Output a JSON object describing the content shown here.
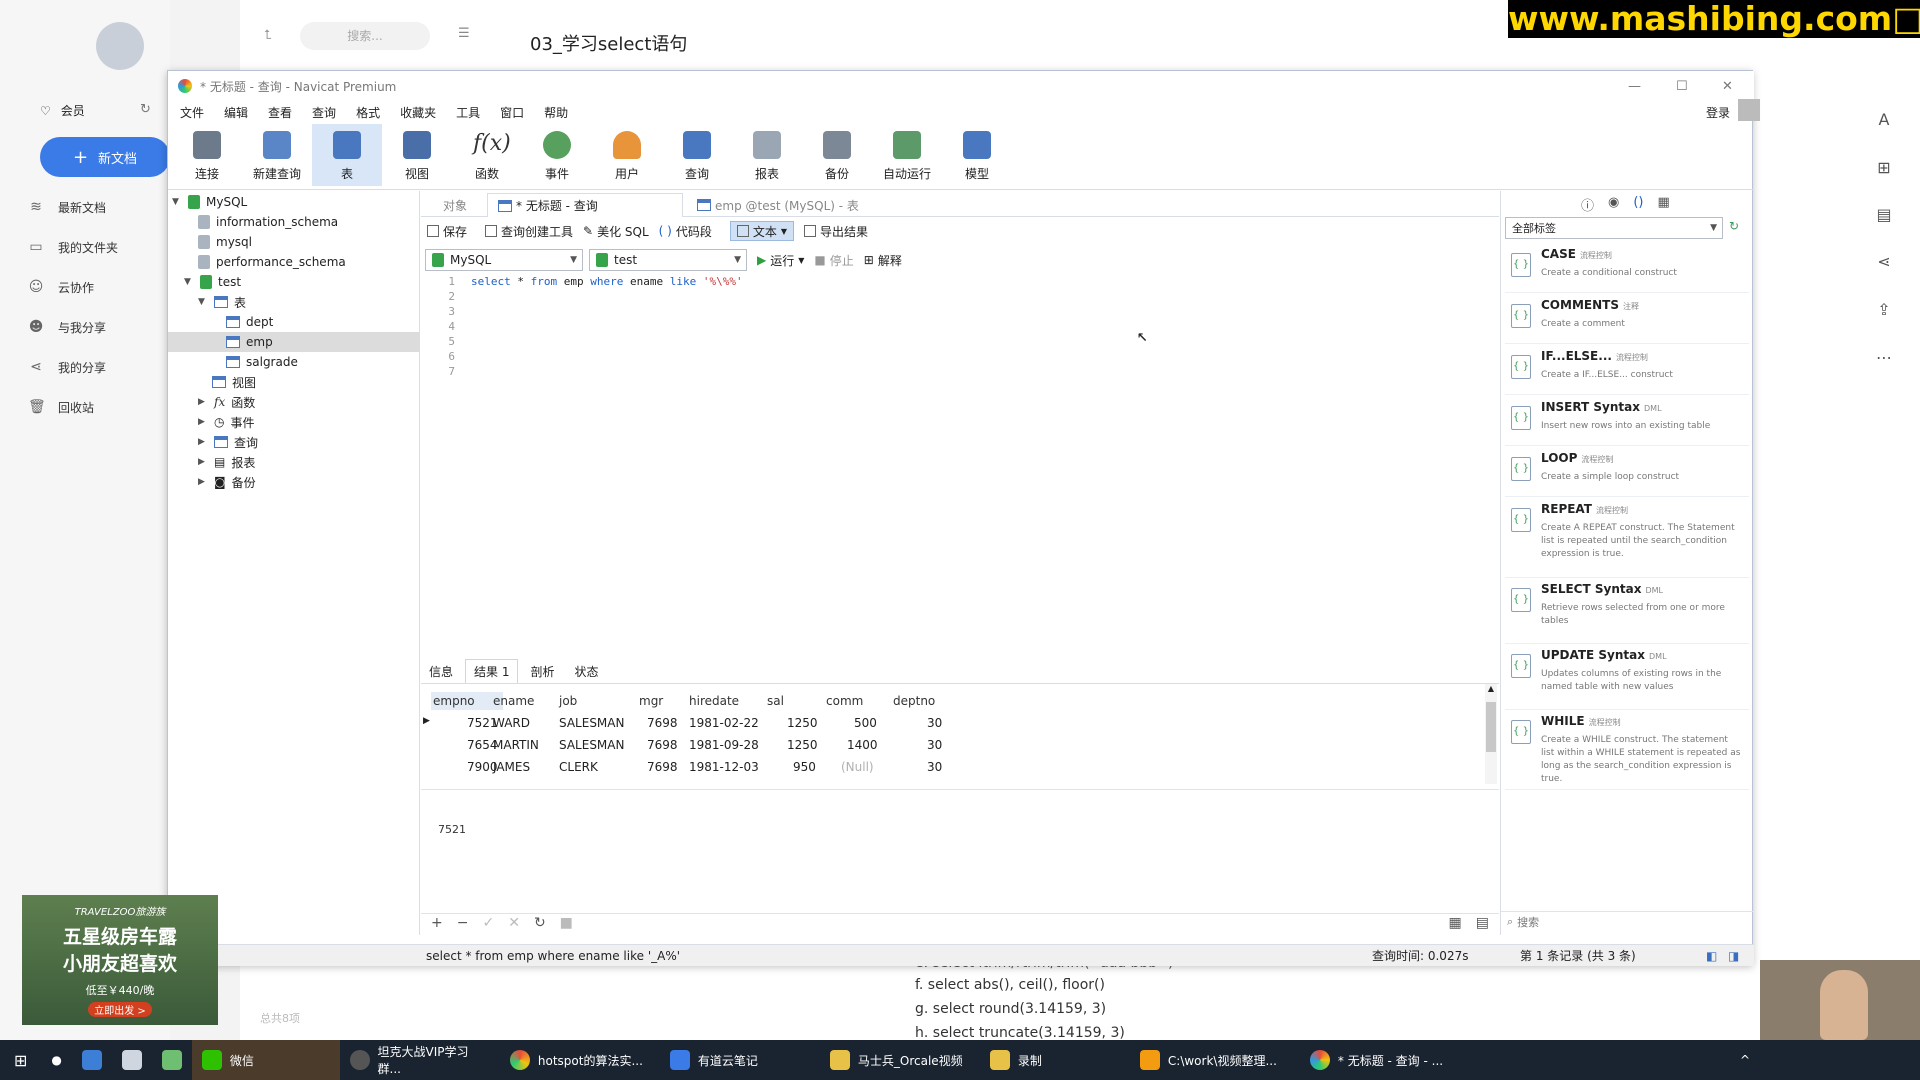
{
  "watermark": "www.mashibing.com□",
  "note_app": {
    "doc_title": "03_学习select语句",
    "search_placeholder": "搜索...",
    "member": "会员",
    "new_doc": "新文档",
    "sidebar": [
      {
        "label": "最新文档"
      },
      {
        "label": "我的文件夹"
      },
      {
        "label": "云协作"
      },
      {
        "label": "与我分享"
      },
      {
        "label": "我的分享"
      },
      {
        "label": "回收站"
      }
    ],
    "total": "总共8项",
    "note_lines": [
      "e. select ltrim/rtrim/trim(\"  aaa bbb  \")",
      "f. select abs(), ceil(), floor()",
      "g. select round(3.14159, 3)",
      "h. select truncate(3.14159, 3)"
    ]
  },
  "ad": {
    "brand": "TRAVELZOO旅游族",
    "line1": "五星级房车露",
    "line2": "小朋友超喜欢",
    "price": "低至￥440/晚",
    "cta": "立即出发 >"
  },
  "window": {
    "title": "* 无标题 - 查询 - Navicat Premium",
    "login": "登录",
    "menu": [
      "文件",
      "编辑",
      "查看",
      "查询",
      "格式",
      "收藏夹",
      "工具",
      "窗口",
      "帮助"
    ],
    "toolbar": [
      {
        "label": "连接"
      },
      {
        "label": "新建查询"
      },
      {
        "label": "表"
      },
      {
        "label": "视图"
      },
      {
        "label": "函数"
      },
      {
        "label": "事件"
      },
      {
        "label": "用户"
      },
      {
        "label": "查询"
      },
      {
        "label": "报表"
      },
      {
        "label": "备份"
      },
      {
        "label": "自动运行"
      },
      {
        "label": "模型"
      }
    ],
    "tree": {
      "root": "MySQL",
      "dbs": [
        "information_schema",
        "mysql",
        "performance_schema",
        "test"
      ],
      "tables_label": "表",
      "tables": [
        "dept",
        "emp",
        "salgrade"
      ],
      "others": [
        "视图",
        "函数",
        "事件",
        "查询",
        "报表",
        "备份"
      ]
    },
    "tabs": [
      "对象",
      "* 无标题 - 查询",
      "emp @test (MySQL) - 表"
    ],
    "query_toolbar": [
      "保存",
      "查询创建工具",
      "美化 SQL",
      "代码段",
      "文本",
      "导出结果"
    ],
    "conn_select": "MySQL",
    "db_select": "test",
    "run": "运行",
    "stop": "停止",
    "explain": "解释",
    "line_numbers": [
      "1",
      "2",
      "3",
      "4",
      "5",
      "6",
      "7"
    ],
    "sql": {
      "k1": "select",
      "star": " * ",
      "k2": "from",
      "t": " emp ",
      "k3": "where",
      "c": " ename ",
      "k4": "like",
      "s": " '%\\%%'"
    },
    "result_tabs": [
      "信息",
      "结果 1",
      "剖析",
      "状态"
    ],
    "columns": [
      "empno",
      "ename",
      "job",
      "mgr",
      "hiredate",
      "sal",
      "comm",
      "deptno"
    ],
    "rows": [
      [
        "7521",
        "WARD",
        "SALESMAN",
        "7698",
        "1981-02-22",
        "1250",
        "500",
        "30"
      ],
      [
        "7654",
        "MARTIN",
        "SALESMAN",
        "7698",
        "1981-09-28",
        "1250",
        "1400",
        "30"
      ],
      [
        "7900",
        "JAMES",
        "CLERK",
        "7698",
        "1981-12-03",
        "950",
        "(Null)",
        "30"
      ]
    ],
    "selected_value": "7521",
    "snippet_filter": "全部标签",
    "snippets": [
      {
        "title": "CASE",
        "tag": "流程控制",
        "desc": "Create a conditional construct"
      },
      {
        "title": "COMMENTS",
        "tag": "注释",
        "desc": "Create a comment"
      },
      {
        "title": "IF...ELSE...",
        "tag": "流程控制",
        "desc": "Create a IF...ELSE... construct"
      },
      {
        "title": "INSERT Syntax",
        "tag": "DML",
        "desc": "Insert new rows into an existing table"
      },
      {
        "title": "LOOP",
        "tag": "流程控制",
        "desc": "Create a simple loop construct"
      },
      {
        "title": "REPEAT",
        "tag": "流程控制",
        "desc": "Create A REPEAT construct. The Statement list is repeated until the search_condition expression is true."
      },
      {
        "title": "SELECT Syntax",
        "tag": "DML",
        "desc": "Retrieve rows selected from one or more tables"
      },
      {
        "title": "UPDATE Syntax",
        "tag": "DML",
        "desc": "Updates columns of existing rows in the named table with new values"
      },
      {
        "title": "WHILE",
        "tag": "流程控制",
        "desc": "Create a WHILE construct. The statement list within a WHILE statement is repeated as long as the search_condition expression is true."
      }
    ],
    "snippet_search": "搜索",
    "status_sql": "select * from emp where ename like '_A%'",
    "query_time": "查询时间: 0.027s",
    "record_info": "第 1 条记录 (共 3 条)"
  },
  "taskbar": [
    {
      "label": "微信"
    },
    {
      "label": "坦克大战VIP学习群..."
    },
    {
      "label": "hotspot的算法实..."
    },
    {
      "label": "有道云笔记"
    },
    {
      "label": "马士兵_Orcale视频"
    },
    {
      "label": "录制"
    },
    {
      "label": "C:\\work\\视频整理..."
    },
    {
      "label": "* 无标题 - 查询 - ..."
    }
  ]
}
